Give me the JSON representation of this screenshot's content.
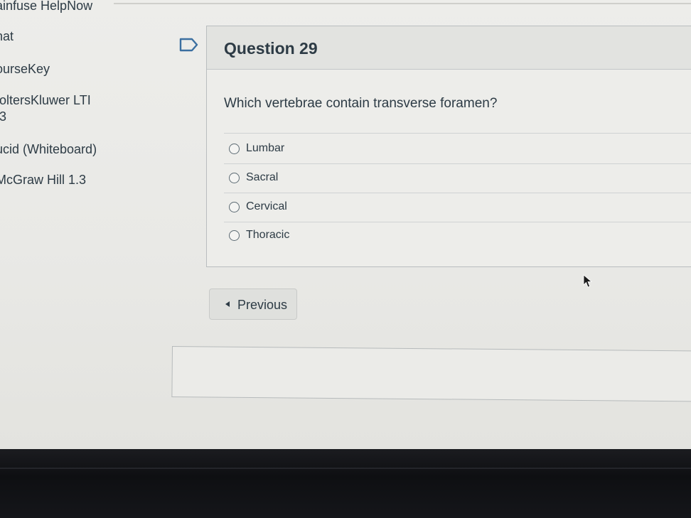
{
  "sidebar": {
    "items": [
      {
        "label": "ainfuse HelpNow"
      },
      {
        "label": "hat"
      },
      {
        "label": "ourseKey"
      },
      {
        "label": "/oltersKluwer LTI"
      },
      {
        "label": ".3"
      },
      {
        "label": "ucid (Whiteboard)"
      },
      {
        "label": "McGraw Hill 1.3"
      }
    ]
  },
  "question": {
    "title": "Question 29",
    "text": "Which vertebrae contain transverse foramen?",
    "answers": [
      {
        "label": "Lumbar"
      },
      {
        "label": "Sacral"
      },
      {
        "label": "Cervical"
      },
      {
        "label": "Thoracic"
      }
    ]
  },
  "navigation": {
    "previous_label": "Previous"
  },
  "colors": {
    "text": "#2d3b45",
    "background": "#ededea",
    "border": "#b9bdbf"
  },
  "icons": {
    "flag": "flag-bookmark-icon",
    "previous": "triangle-left-icon",
    "radio": "radio-circle-icon",
    "cursor": "mouse-pointer-icon"
  }
}
